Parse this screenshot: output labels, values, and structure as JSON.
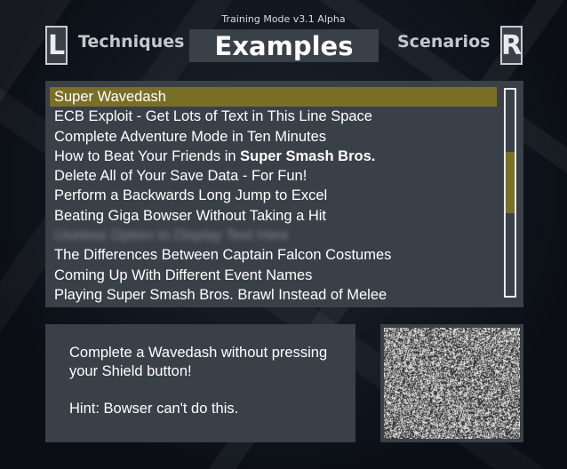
{
  "header": {
    "version": "Training Mode v3.1 Alpha",
    "left_shoulder": "L",
    "right_shoulder": "R",
    "tabs": [
      "Techniques",
      "Examples",
      "Scenarios"
    ],
    "active_tab": "Examples"
  },
  "list": {
    "selected_index": 0,
    "items": [
      {
        "text": "Super Wavedash"
      },
      {
        "text": "ECB Exploit - Get Lots of Text in This Line Space"
      },
      {
        "text": "Complete Adventure Mode in Ten Minutes"
      },
      {
        "text": "How to Beat Your Friends in ",
        "bold": "Super Smash Bros."
      },
      {
        "text": "Delete All of Your Save Data - For Fun!"
      },
      {
        "text": "Perform a Backwards Long Jump to Excel"
      },
      {
        "text": "Beating Giga Bowser Without Taking a Hit"
      },
      {
        "text": "Useless Option to Display Text Here"
      },
      {
        "text": "The Differences Between Captain Falcon Costumes"
      },
      {
        "text": "Coming Up With Different Event Names"
      },
      {
        "text": "Playing Super Smash Bros. Brawl Instead of Melee"
      }
    ],
    "scroll_position": 0.3,
    "scroll_thumb_fraction": 0.3
  },
  "description": {
    "text": "Complete a Wavedash without pressing your Shield button!",
    "hint": "Hint: Bowser can't do this."
  },
  "colors": {
    "panel": "#3a4048",
    "highlight": "#7a6f27",
    "text": "#ffffff"
  },
  "preview": {
    "icon": "static-noise-preview"
  }
}
